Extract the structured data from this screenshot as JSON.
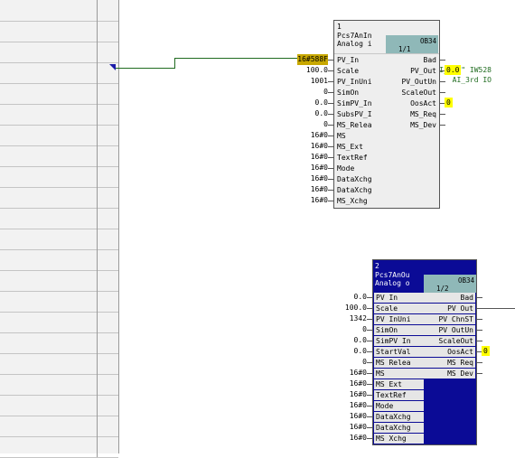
{
  "left_panel": {
    "rows": 22,
    "symbol": "\"AI_3rd\" IW528",
    "comment": "AI_3rd IO"
  },
  "block1": {
    "number": "1",
    "type": "Pcs7AnIn",
    "comment": "Analog i",
    "ob": "OB34",
    "seq": "1/1",
    "inputs": [
      {
        "name": "PV_In",
        "value": "16#588F",
        "highlight": true
      },
      {
        "name": "Scale",
        "value": "100.0"
      },
      {
        "name": "PV_InUni",
        "value": "1001"
      },
      {
        "name": "SimOn",
        "value": "0"
      },
      {
        "name": "SimPV_In",
        "value": "0.0"
      },
      {
        "name": "SubsPV_I",
        "value": "0.0"
      },
      {
        "name": "MS_Relea",
        "value": "0"
      },
      {
        "name": "MS",
        "value": "16#0"
      },
      {
        "name": "MS_Ext",
        "value": "16#0"
      },
      {
        "name": "TextRef",
        "value": "16#0"
      },
      {
        "name": "Mode",
        "value": "16#0"
      },
      {
        "name": "DataXchg",
        "value": "16#0"
      },
      {
        "name": "DataXchg",
        "value": "16#0"
      },
      {
        "name": "MS_Xchg",
        "value": "16#0"
      }
    ],
    "outputs": [
      {
        "name": "Bad",
        "value": ""
      },
      {
        "name": "PV_Out",
        "value": "0.0"
      },
      {
        "name": "PV_OutUn",
        "value": ""
      },
      {
        "name": "ScaleOut",
        "value": ""
      },
      {
        "name": "OosAct",
        "value": "0"
      },
      {
        "name": "MS_Req",
        "value": ""
      },
      {
        "name": "MS_Dev",
        "value": ""
      }
    ]
  },
  "block2": {
    "number": "2",
    "type": "Pcs7AnOu",
    "comment": "Analog o",
    "ob": "OB34",
    "seq": "1/2",
    "inputs": [
      {
        "name": "PV In",
        "value": "0.0"
      },
      {
        "name": "Scale",
        "value": "100.0"
      },
      {
        "name": "PV InUni",
        "value": "1342"
      },
      {
        "name": "SimOn",
        "value": "0"
      },
      {
        "name": "SimPV In",
        "value": "0.0"
      },
      {
        "name": "StartVal",
        "value": "0.0"
      },
      {
        "name": "MS Relea",
        "value": "0"
      },
      {
        "name": "MS",
        "value": "16#0"
      },
      {
        "name": "MS Ext",
        "value": "16#0"
      },
      {
        "name": "TextRef",
        "value": "16#0"
      },
      {
        "name": "Mode",
        "value": "16#0"
      },
      {
        "name": "DataXchg",
        "value": "16#0"
      },
      {
        "name": "DataXchg",
        "value": "16#0"
      },
      {
        "name": "MS Xchg",
        "value": "16#0"
      }
    ],
    "outputs": [
      {
        "name": "Bad",
        "value": ""
      },
      {
        "name": "PV Out",
        "value": ""
      },
      {
        "name": "PV ChnST",
        "value": ""
      },
      {
        "name": "PV OutUn",
        "value": ""
      },
      {
        "name": "ScaleOut",
        "value": ""
      },
      {
        "name": "OosAct",
        "value": "0"
      },
      {
        "name": "MS Req",
        "value": ""
      },
      {
        "name": "MS Dev",
        "value": ""
      }
    ]
  }
}
